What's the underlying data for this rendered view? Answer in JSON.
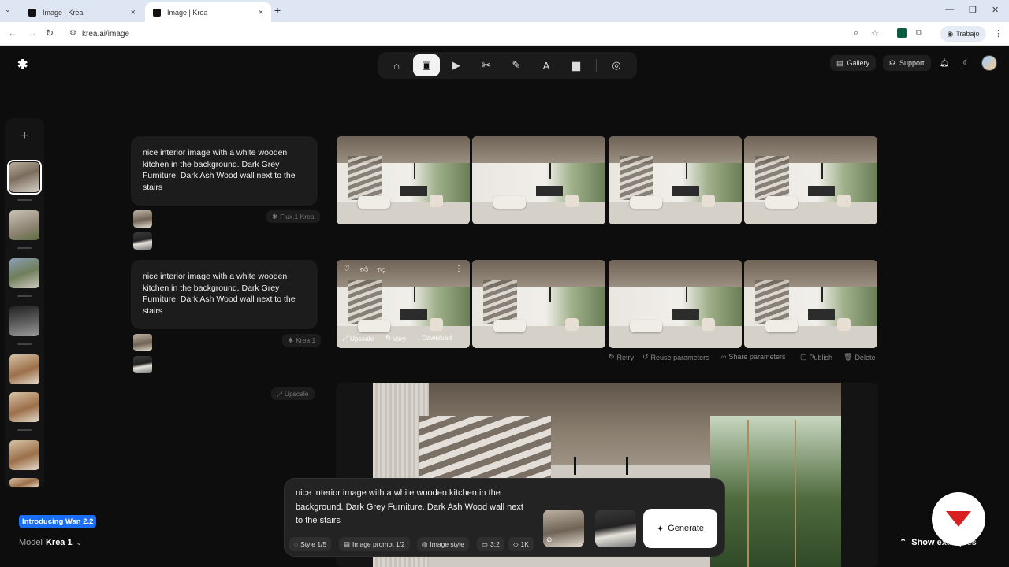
{
  "browser": {
    "tabs": [
      {
        "title": "Image | Krea"
      },
      {
        "title": "Image | Krea"
      }
    ],
    "url": "krea.ai/image",
    "profile": "Trabajo"
  },
  "toolbar": {
    "tools": [
      "home-icon",
      "image-icon",
      "video-icon",
      "enhance-icon",
      "edit-icon",
      "train-icon",
      "assets-icon",
      "realtime-icon"
    ],
    "active": "image"
  },
  "header": {
    "gallery_label": "Gallery",
    "support_label": "Support"
  },
  "generations": [
    {
      "prompt": "nice interior image with a white wooden kitchen in the background. Dark Grey Furniture. Dark Ash Wood wall next to the stairs",
      "model": "Flux.1 Krea"
    },
    {
      "prompt": "nice interior image with a white wooden kitchen in the background. Dark Grey Furniture. Dark Ash Wood wall next to the stairs",
      "model": "Krea 1"
    }
  ],
  "image_actions": {
    "upscale": "Upscale",
    "vary": "Vary",
    "download": "Download"
  },
  "row_actions": {
    "retry": "Retry",
    "reuse": "Reuse parameters",
    "share": "Share parameters",
    "publish": "Publish",
    "delete": "Delete"
  },
  "upscale_badge": "Upscale",
  "prompt_bar": {
    "text": "nice interior image with a white wooden kitchen in the background. Dark Grey Furniture. Dark Ash Wood wall next to the stairs",
    "generate_label": "Generate",
    "chips": {
      "style": "Style 1/5",
      "image_prompt": "Image prompt 1/2",
      "image_style": "Image style",
      "aspect": "3:2",
      "resolution": "1K"
    }
  },
  "footer": {
    "intro": "Introducing Wan 2.2",
    "model_label": "Model",
    "model_value": "Krea 1",
    "show_examples": "Show examples"
  },
  "colors": {
    "background": "#0d0d0d",
    "accent_blue": "#1a6ef5",
    "badge_red": "#d91f1f"
  }
}
